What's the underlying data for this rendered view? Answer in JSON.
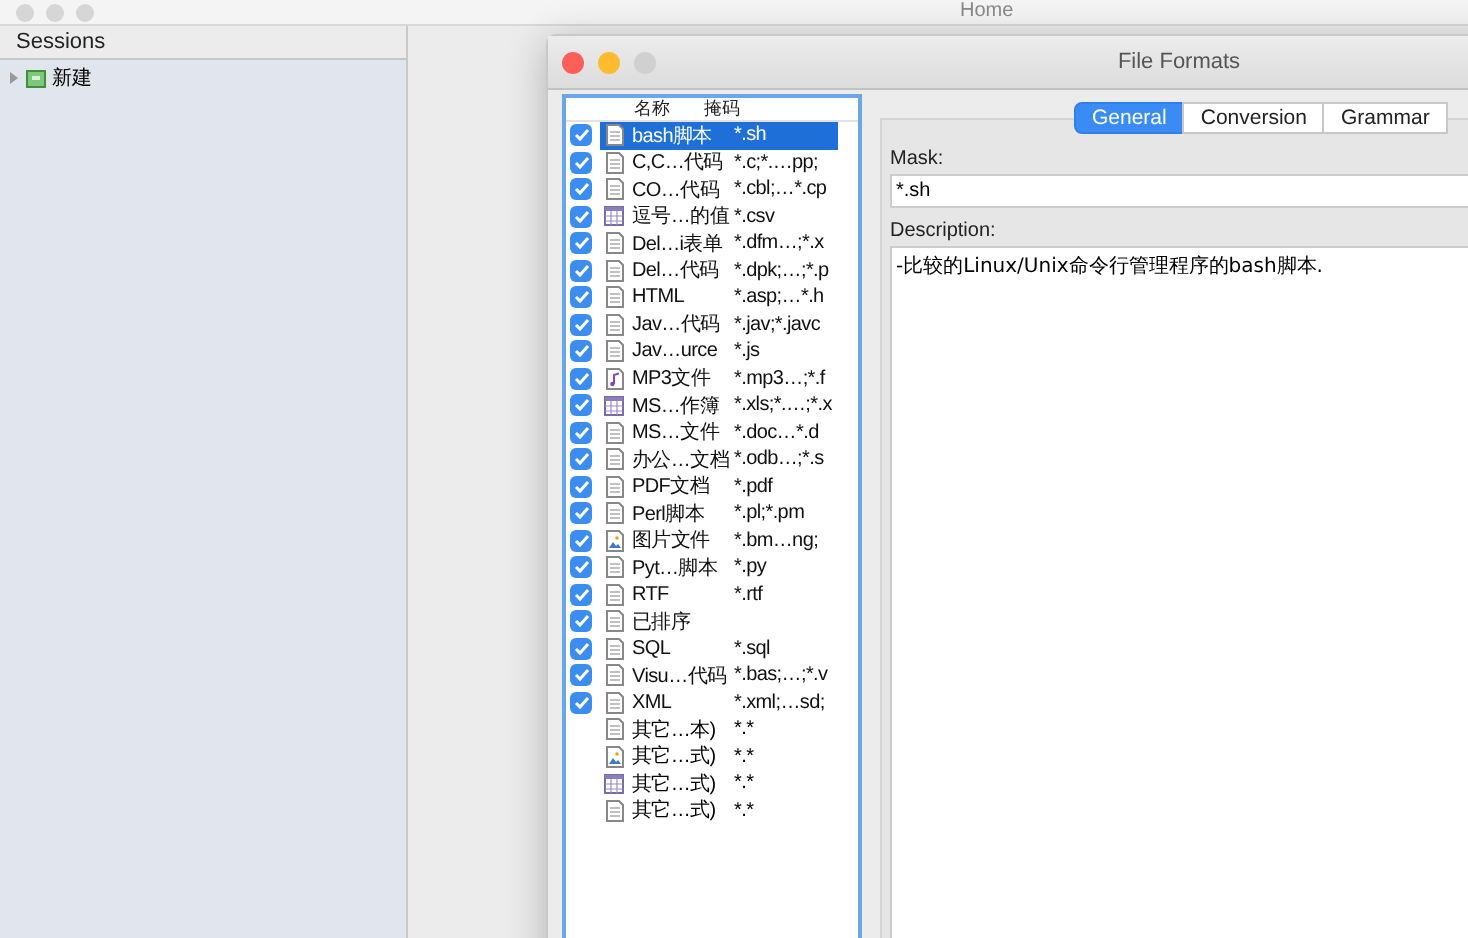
{
  "back_window": {
    "title": "Home"
  },
  "sessions": {
    "header": "Sessions",
    "items": [
      {
        "label": "新建",
        "expanded": false
      }
    ]
  },
  "dialog": {
    "title": "File Formats",
    "list": {
      "columns": [
        "名称",
        "掩码"
      ],
      "rows": [
        {
          "name": "bash脚本",
          "mask": "*.sh",
          "kind": "doc",
          "checked": true,
          "selected": true
        },
        {
          "name": "C,C…代码",
          "mask": "*.c;*.…pp;",
          "kind": "doc",
          "checked": true,
          "selected": false
        },
        {
          "name": "CO…代码",
          "mask": "*.cbl;…*.cp",
          "kind": "doc",
          "checked": true,
          "selected": false
        },
        {
          "name": "逗号…的值",
          "mask": "*.csv",
          "kind": "table",
          "checked": true,
          "selected": false
        },
        {
          "name": "Del…i表单",
          "mask": "*.dfm…;*.x",
          "kind": "doc",
          "checked": true,
          "selected": false
        },
        {
          "name": "Del…代码",
          "mask": "*.dpk;…;*.p",
          "kind": "doc",
          "checked": true,
          "selected": false
        },
        {
          "name": "HTML",
          "mask": "*.asp;…*.h",
          "kind": "doc",
          "checked": true,
          "selected": false
        },
        {
          "name": "Jav…代码",
          "mask": "*.jav;*.javc",
          "kind": "doc",
          "checked": true,
          "selected": false
        },
        {
          "name": "Jav…urce",
          "mask": "*.js",
          "kind": "doc",
          "checked": true,
          "selected": false
        },
        {
          "name": "MP3文件",
          "mask": "*.mp3…;*.f",
          "kind": "audio",
          "checked": true,
          "selected": false
        },
        {
          "name": "MS…作簿",
          "mask": "*.xls;*.…;*.x",
          "kind": "table",
          "checked": true,
          "selected": false
        },
        {
          "name": "MS…文件",
          "mask": "*.doc…*.d",
          "kind": "doc",
          "checked": true,
          "selected": false
        },
        {
          "name": "办公…文档",
          "mask": "*.odb…;*.s",
          "kind": "doc",
          "checked": true,
          "selected": false
        },
        {
          "name": "PDF文档",
          "mask": "*.pdf",
          "kind": "doc",
          "checked": true,
          "selected": false
        },
        {
          "name": "Perl脚本",
          "mask": "*.pl;*.pm",
          "kind": "doc",
          "checked": true,
          "selected": false
        },
        {
          "name": "图片文件",
          "mask": "*.bm…ng;",
          "kind": "image",
          "checked": true,
          "selected": false
        },
        {
          "name": "Pyt…脚本",
          "mask": "*.py",
          "kind": "doc",
          "checked": true,
          "selected": false
        },
        {
          "name": "RTF",
          "mask": "*.rtf",
          "kind": "doc",
          "checked": true,
          "selected": false
        },
        {
          "name": "已排序",
          "kind": "doc",
          "checked": true,
          "selected": false
        },
        {
          "name": "SQL",
          "mask": "*.sql",
          "kind": "doc",
          "checked": true,
          "selected": false
        },
        {
          "name": "Visu…代码",
          "mask": "*.bas;…;*.v",
          "kind": "doc",
          "checked": true,
          "selected": false
        },
        {
          "name": "XML",
          "mask": "*.xml;…sd;",
          "kind": "doc",
          "checked": true,
          "selected": false
        }
      ],
      "other_rows": [
        {
          "name": "其它…本)",
          "mask": "*.*",
          "kind": "doc"
        },
        {
          "name": "其它…式)",
          "mask": "*.*",
          "kind": "image"
        },
        {
          "name": "其它…式)",
          "mask": "*.*",
          "kind": "table"
        },
        {
          "name": "其它…式)",
          "mask": "*.*",
          "kind": "doc"
        }
      ]
    },
    "tabs": [
      {
        "label": "General",
        "selected": true
      },
      {
        "label": "Conversion",
        "selected": false
      },
      {
        "label": "Grammar",
        "selected": false
      }
    ],
    "mask": {
      "label": "Mask:",
      "value": "*.sh"
    },
    "description": {
      "label": "Description:",
      "value": "-比较的Linux/Unix命令行管理程序的bash脚本."
    }
  }
}
